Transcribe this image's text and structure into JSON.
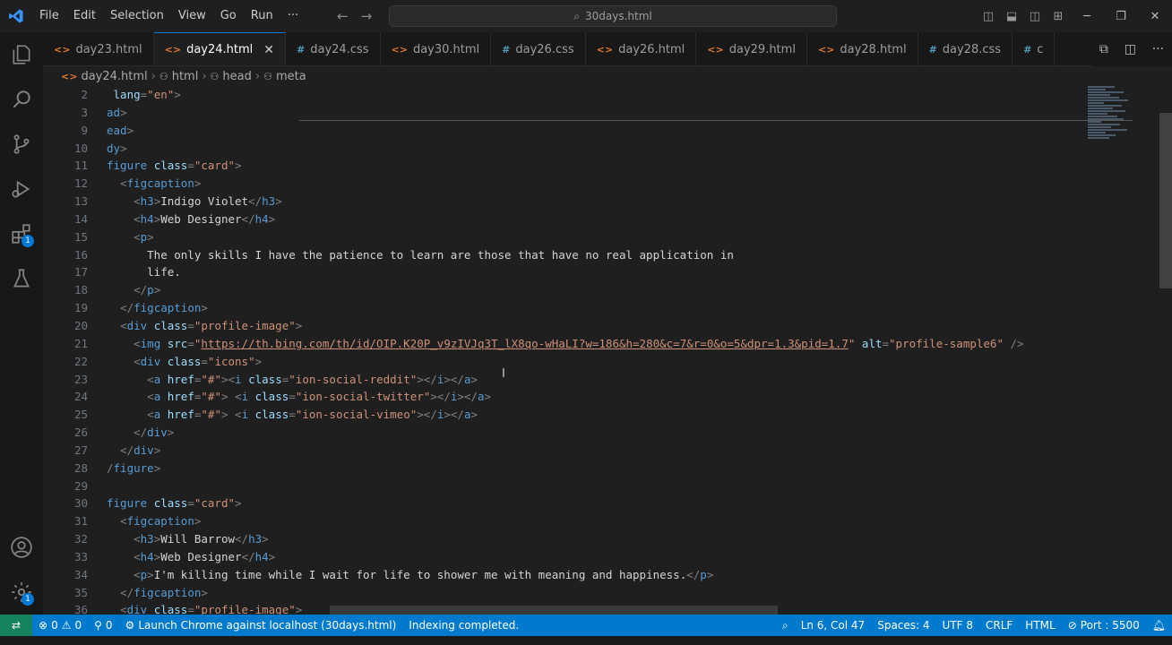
{
  "titlebar": {
    "menu": [
      "File",
      "Edit",
      "Selection",
      "View",
      "Go",
      "Run",
      "···"
    ],
    "search": "30days.html"
  },
  "tabs": [
    {
      "icon": "<>",
      "type": "html",
      "label": "day23.html"
    },
    {
      "icon": "<>",
      "type": "html",
      "label": "day24.html",
      "active": true
    },
    {
      "icon": "#",
      "type": "css",
      "label": "day24.css"
    },
    {
      "icon": "<>",
      "type": "html",
      "label": "day30.html"
    },
    {
      "icon": "#",
      "type": "css",
      "label": "day26.css"
    },
    {
      "icon": "<>",
      "type": "html",
      "label": "day26.html"
    },
    {
      "icon": "<>",
      "type": "html",
      "label": "day29.html"
    },
    {
      "icon": "<>",
      "type": "html",
      "label": "day28.html"
    },
    {
      "icon": "#",
      "type": "css",
      "label": "day28.css"
    },
    {
      "icon": "#",
      "type": "css",
      "label": "c"
    }
  ],
  "breadcrumb": {
    "file": "day24.html",
    "html": "html",
    "head": "head",
    "meta": "meta"
  },
  "editor": {
    "line_numbers": [
      "2",
      "3",
      "9",
      "10",
      "11",
      "12",
      "13",
      "14",
      "15",
      "16",
      "17",
      "18",
      "19",
      "20",
      "21",
      "22",
      "23",
      "24",
      "25",
      "26",
      "27",
      "28",
      "29",
      "30",
      "31",
      "32",
      "33",
      "34",
      "35",
      "36"
    ]
  },
  "status": {
    "errors": "0",
    "warnings": "0",
    "ports": "0",
    "launch": "Launch Chrome against localhost (30days.html)",
    "indexing": "Indexing completed.",
    "position": "Ln 6, Col 47",
    "spaces": "Spaces: 4",
    "encoding": "UTF 8",
    "eol": "CRLF",
    "language": "HTML",
    "port": "Port : 5500"
  },
  "activity_badges": {
    "extensions": "1",
    "settings": "1"
  }
}
